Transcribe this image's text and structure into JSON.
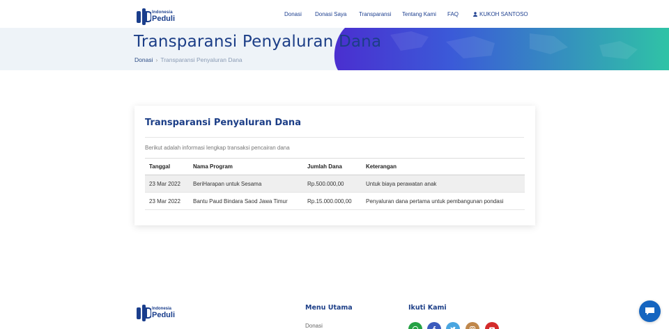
{
  "brand": {
    "small": "Indonesia",
    "big": "Peduli"
  },
  "nav": {
    "items": [
      {
        "label": "Donasi"
      },
      {
        "label": "Donasi Saya"
      },
      {
        "label": "Transparansi"
      },
      {
        "label": "Tentang Kami"
      },
      {
        "label": "FAQ"
      }
    ],
    "user": "KUKOH SANTOSO"
  },
  "banner": {
    "title": "Transparansi Penyaluran Dana",
    "breadcrumb": {
      "link": "Donasi",
      "separator": "›",
      "current": "Transparansi Penyaluran Dana"
    }
  },
  "card": {
    "title": "Transparansi Penyaluran Dana",
    "description": "Berikut adalah informasi lengkap transaksi pencairan dana",
    "columns": [
      "Tanggal",
      "Nama Program",
      "Jumlah Dana",
      "Keterangan"
    ],
    "rows": [
      [
        "23 Mar 2022",
        "BeriHarapan untuk Sesama",
        "Rp.500.000,00",
        "Untuk biaya perawatan anak"
      ],
      [
        "23 Mar 2022",
        "Bantu Paud Bindara Saod Jawa Timur",
        "Rp.15.000.000,00",
        "Penyaluran dana pertama untuk pembangunan pondasi"
      ]
    ]
  },
  "footer": {
    "menu_title": "Menu Utama",
    "menu_items": [
      "Donasi"
    ],
    "follow_title": "Ikuti Kami",
    "socials": [
      {
        "icon": "whatsapp-icon",
        "color": "#25a244"
      },
      {
        "icon": "facebook-icon",
        "color": "#3b5bbd"
      },
      {
        "icon": "twitter-icon",
        "color": "#4aa6e0"
      },
      {
        "icon": "instagram-icon",
        "color": "#c0874a"
      },
      {
        "icon": "youtube-icon",
        "color": "#d42b2b"
      }
    ]
  },
  "colors": {
    "primary": "#1c3e87",
    "banner_gradient_start": "#5b2fd6",
    "banner_gradient_end": "#2ec7a8",
    "chat": "#1565c0"
  }
}
